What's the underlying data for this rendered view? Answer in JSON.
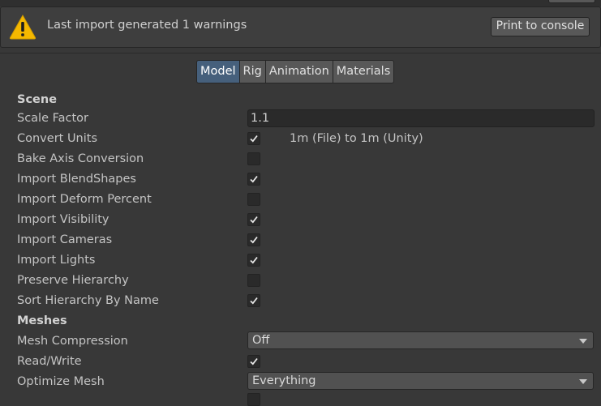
{
  "warning": {
    "message": "Last import generated 1 warnings",
    "print_label": "Print to console"
  },
  "tabs": [
    {
      "label": "Model",
      "active": true
    },
    {
      "label": "Rig",
      "active": false
    },
    {
      "label": "Animation",
      "active": false
    },
    {
      "label": "Materials",
      "active": false
    }
  ],
  "scene": {
    "header": "Scene",
    "scale_factor_label": "Scale Factor",
    "scale_factor_value": "1.1",
    "convert_units_label": "Convert Units",
    "convert_units_checked": true,
    "convert_units_info": "1m (File) to 1m (Unity)",
    "bake_axis_label": "Bake Axis Conversion",
    "bake_axis_checked": false,
    "blendshapes_label": "Import BlendShapes",
    "blendshapes_checked": true,
    "deform_percent_label": "Import Deform Percent",
    "deform_percent_checked": false,
    "visibility_label": "Import Visibility",
    "visibility_checked": true,
    "cameras_label": "Import Cameras",
    "cameras_checked": true,
    "lights_label": "Import Lights",
    "lights_checked": true,
    "preserve_hierarchy_label": "Preserve Hierarchy",
    "preserve_hierarchy_checked": false,
    "sort_hierarchy_label": "Sort Hierarchy By Name",
    "sort_hierarchy_checked": true
  },
  "meshes": {
    "header": "Meshes",
    "compression_label": "Mesh Compression",
    "compression_value": "Off",
    "read_write_label": "Read/Write",
    "read_write_checked": true,
    "optimize_label": "Optimize Mesh",
    "optimize_value": "Everything"
  },
  "colors": {
    "background": "#383838",
    "active_tab": "#46607c",
    "warning_yellow": "#f5b800"
  },
  "icons": {
    "warning": "warning-triangle-icon",
    "check": "checkmark-icon",
    "dropdown": "caret-down-icon"
  }
}
